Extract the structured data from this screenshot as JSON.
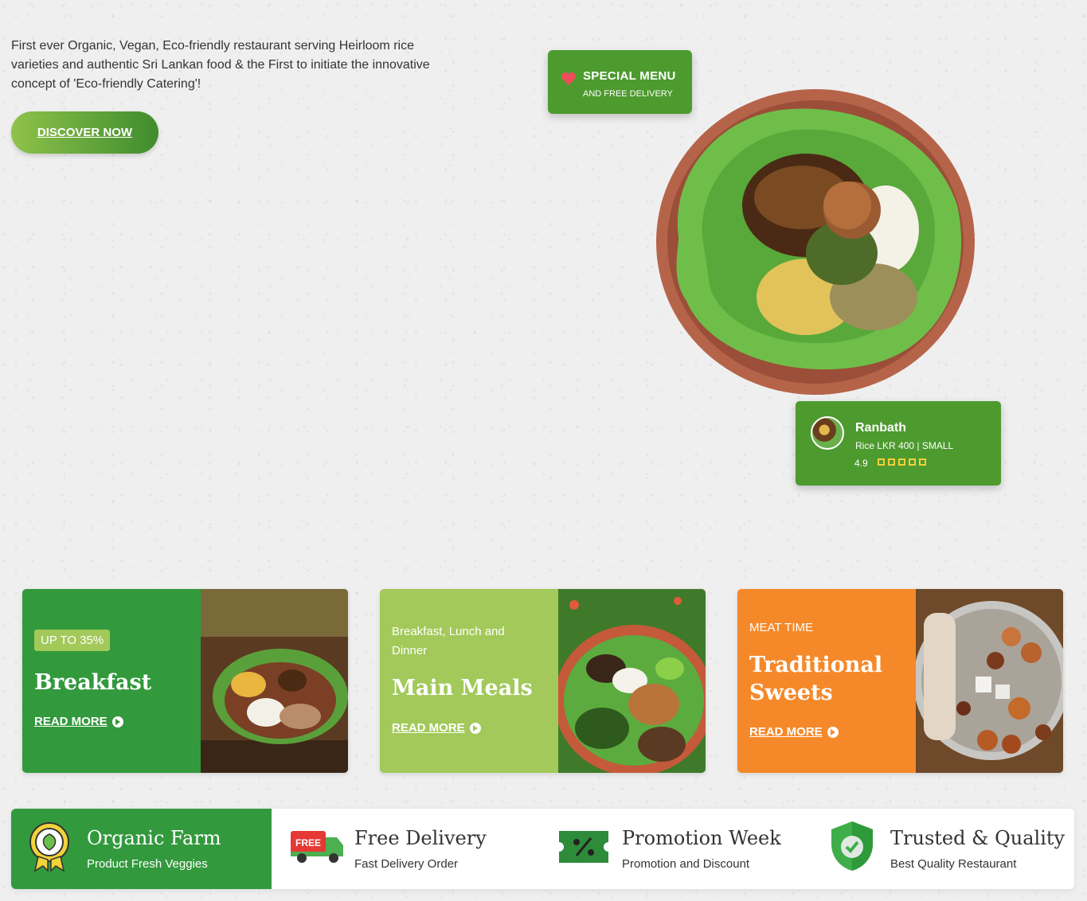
{
  "hero": {
    "description": "First ever Organic, Vegan, Eco-friendly restaurant serving Heirloom rice varieties and authentic Sri Lankan food & the First to initiate the innovative concept of 'Eco-friendly Catering'!",
    "cta_label": "DISCOVER NOW"
  },
  "special_menu": {
    "title": "SPECIAL MENU",
    "subtitle": "AND FREE DELIVERY",
    "icon": "heart-icon"
  },
  "featured_item": {
    "name": "Ranbath",
    "meta": "Rice LKR 400 | SMALL",
    "rating": "4.9",
    "stars": 5
  },
  "promo_cards": [
    {
      "tag": "UP TO 35%",
      "title": "Breakfast",
      "link": "READ MORE",
      "bg": "#33993d"
    },
    {
      "tag": "Breakfast, Lunch and Dinner",
      "title": "Main Meals",
      "link": "READ MORE",
      "bg": "#a2c95a"
    },
    {
      "tag": "MEAT TIME",
      "title": "Traditional Sweets",
      "link": "READ MORE",
      "bg": "#f5892a"
    }
  ],
  "features": [
    {
      "title": "Organic Farm",
      "subtitle": "Product Fresh Veggies",
      "icon": "organic-badge-icon"
    },
    {
      "title": "Free Delivery",
      "subtitle": "Fast Delivery Order",
      "icon": "delivery-truck-icon",
      "badge": "FREE"
    },
    {
      "title": "Promotion Week",
      "subtitle": "Promotion and Discount",
      "icon": "discount-ticket-icon"
    },
    {
      "title": "Trusted & Quality",
      "subtitle": "Best Quality Restaurant",
      "icon": "shield-check-icon"
    }
  ],
  "colors": {
    "brand_green": "#4d9a2f",
    "feature_green": "#33993d",
    "light_green": "#a2c95a",
    "orange": "#f5892a"
  }
}
